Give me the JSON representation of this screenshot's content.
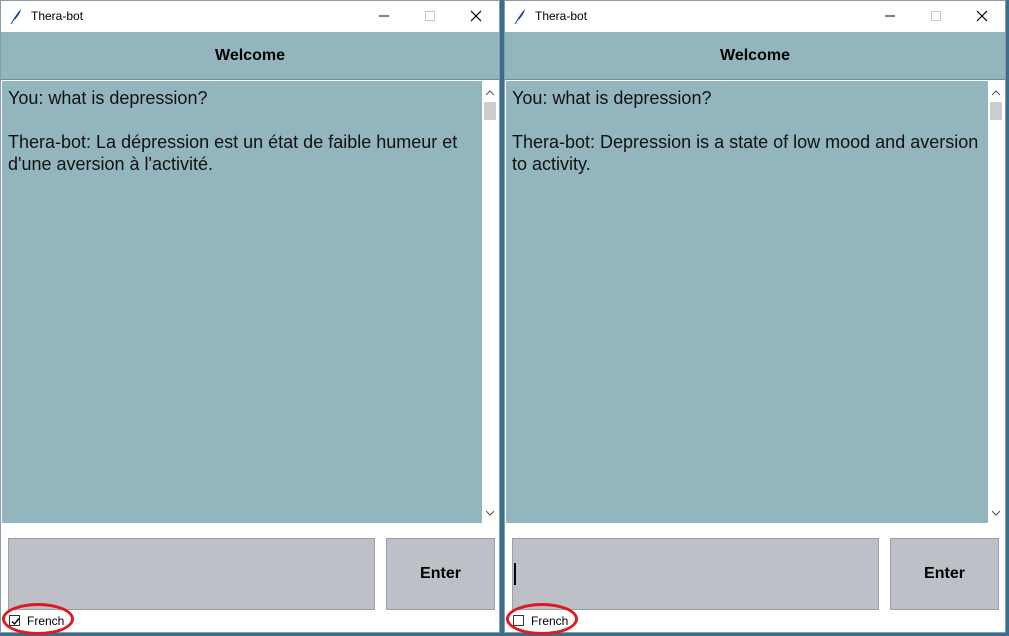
{
  "colors": {
    "panel": "#93b6be",
    "input": "#bdc0c7",
    "highlight": "#e0191f"
  },
  "windows": [
    {
      "title": "Thera-bot",
      "header": "Welcome",
      "messages": [
        "You: what is depression?",
        "Thera-bot: La dépression est un état de faible humeur et d'une aversion à l'activité."
      ],
      "input_value": "",
      "enter_label": "Enter",
      "french_label": "French",
      "french_checked": true
    },
    {
      "title": "Thera-bot",
      "header": "Welcome",
      "messages": [
        "You: what is depression?",
        "Thera-bot: Depression is a state of low mood and aversion to activity."
      ],
      "input_value": "",
      "enter_label": "Enter",
      "french_label": "French",
      "french_checked": false
    }
  ]
}
